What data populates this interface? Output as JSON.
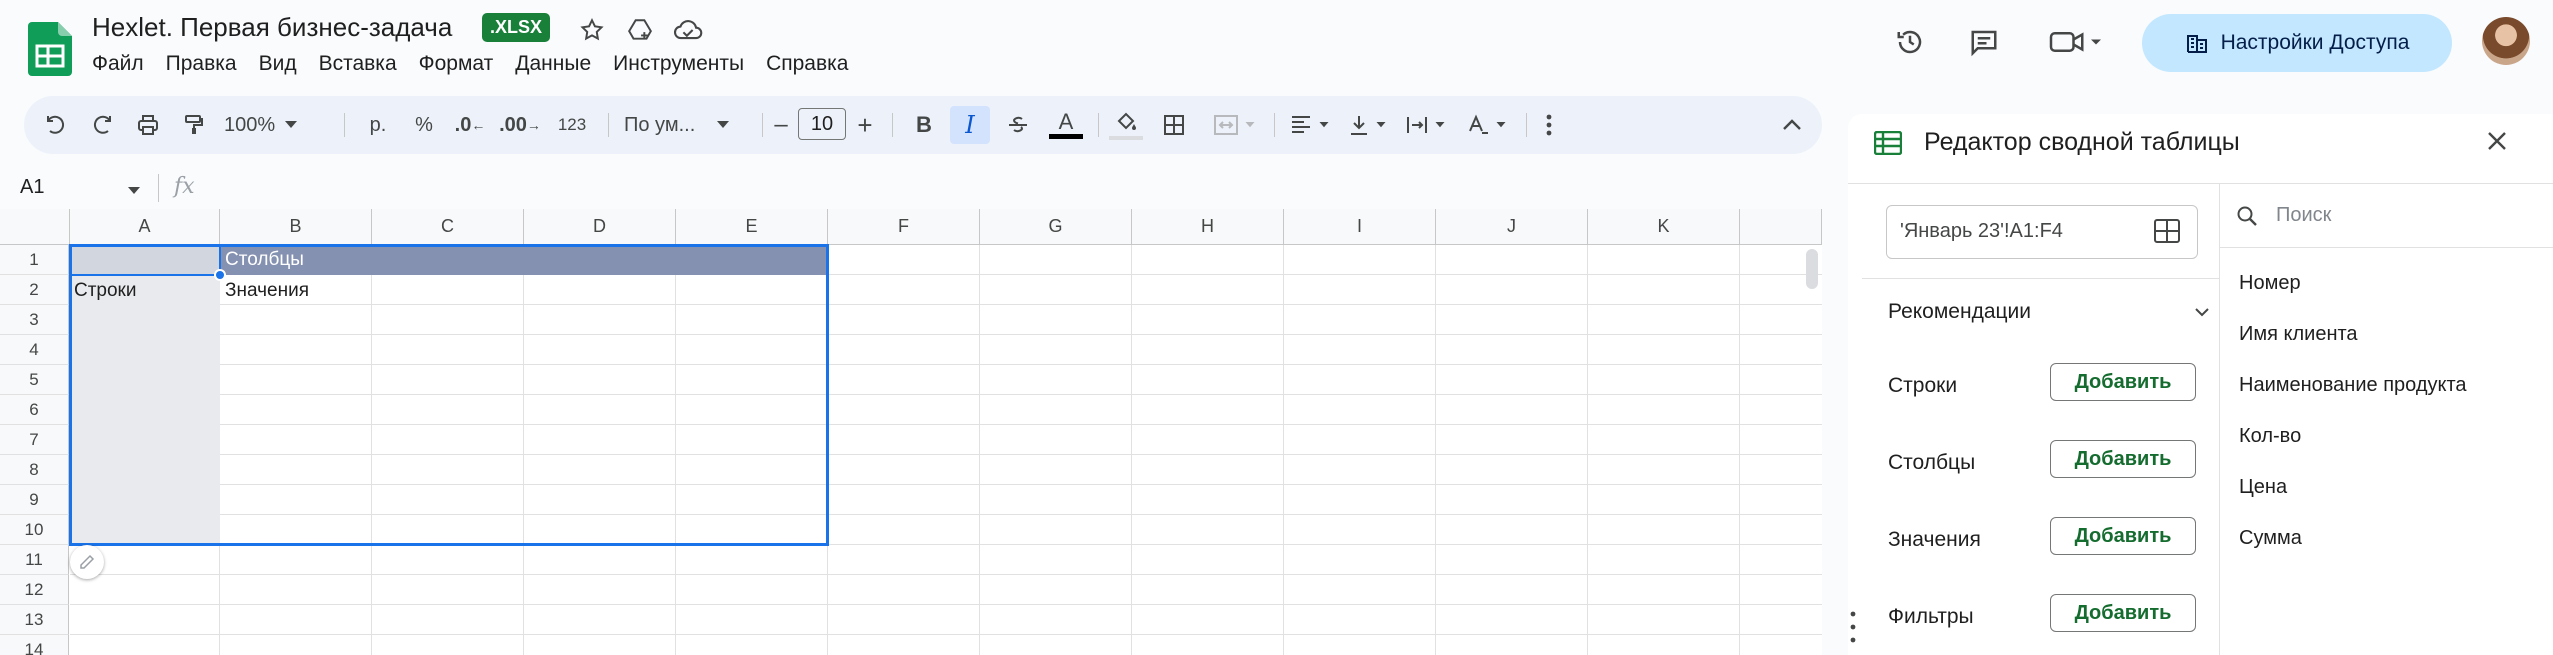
{
  "app": {
    "doc_title": "Hexlet. Первая бизнес-задача",
    "format_badge": ".XLSX"
  },
  "menu": [
    "Файл",
    "Правка",
    "Вид",
    "Вставка",
    "Формат",
    "Данные",
    "Инструменты",
    "Справка"
  ],
  "share": {
    "label": "Настройки Доступа",
    "color": "#c2e7ff"
  },
  "toolbar": {
    "zoom": "100%",
    "currency": "р.",
    "percent": "%",
    "dec_decrease": ".0",
    "dec_increase": ".00",
    "number_format": "123",
    "font": "По ум...",
    "font_size": "10",
    "minus": "–",
    "plus": "+",
    "bold": "B",
    "italic": "I",
    "text_color_letter": "A"
  },
  "formula": {
    "name_box": "A1",
    "fx": "fx"
  },
  "sheet": {
    "columns": [
      "A",
      "B",
      "C",
      "D",
      "E",
      "F",
      "G",
      "H",
      "I",
      "J",
      "K"
    ],
    "rows": [
      "1",
      "2",
      "3",
      "4",
      "5",
      "6",
      "7",
      "8",
      "9",
      "10",
      "11",
      "12",
      "13",
      "14"
    ],
    "cells": {
      "B1": "Столбцы",
      "A2": "Строки",
      "B2": "Значения"
    },
    "header_fill": "#8591b1",
    "selection_color": "#1a73e8"
  },
  "pivot": {
    "title": "Редактор сводной таблицы",
    "range": "'Январь 23'!A1:F4",
    "recommendations": "Рекомендации",
    "sections": [
      {
        "label": "Строки",
        "button": "Добавить"
      },
      {
        "label": "Столбцы",
        "button": "Добавить"
      },
      {
        "label": "Значения",
        "button": "Добавить"
      },
      {
        "label": "Фильтры",
        "button": "Добавить"
      }
    ],
    "search_placeholder": "Поиск",
    "fields": [
      "Номер",
      "Имя клиента",
      "Наименование продукта",
      "Кол-во",
      "Цена",
      "Сумма"
    ],
    "accent": "#188038"
  }
}
